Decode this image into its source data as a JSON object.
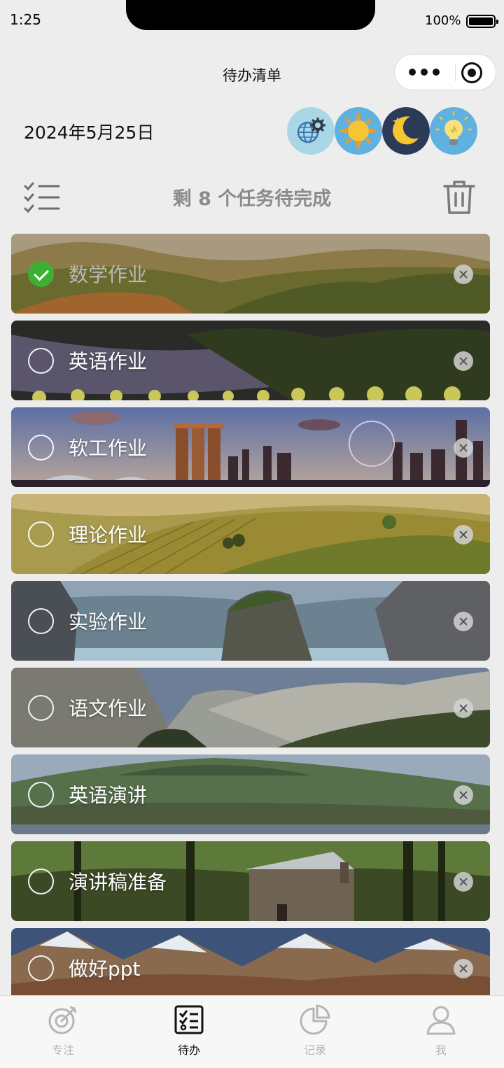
{
  "status_bar": {
    "time": "1:25",
    "battery": "100%"
  },
  "nav": {
    "title": "待办清单"
  },
  "header": {
    "date": "2024年5月25日",
    "theme_icons": [
      "globe-gear-icon",
      "sun-icon",
      "moon-icon",
      "lightbulb-icon"
    ]
  },
  "toolbar": {
    "remaining": "剩 8 个任务待完成"
  },
  "tasks": [
    {
      "label": "数学作业",
      "done": true
    },
    {
      "label": "英语作业",
      "done": false
    },
    {
      "label": "软工作业",
      "done": false
    },
    {
      "label": "理论作业",
      "done": false
    },
    {
      "label": "实验作业",
      "done": false
    },
    {
      "label": "语文作业",
      "done": false
    },
    {
      "label": "英语演讲",
      "done": false
    },
    {
      "label": "演讲稿准备",
      "done": false
    },
    {
      "label": "做好ppt",
      "done": false
    }
  ],
  "tabs": [
    {
      "label": "专注",
      "icon": "focus-icon",
      "active": false
    },
    {
      "label": "待办",
      "icon": "todo-icon",
      "active": true
    },
    {
      "label": "记录",
      "icon": "pie-chart-icon",
      "active": false
    },
    {
      "label": "我",
      "icon": "user-icon",
      "active": false
    }
  ],
  "colors": {
    "check_done": "#3cb034",
    "active_tab": "#111111",
    "inactive_tab": "#b5b5b5"
  }
}
